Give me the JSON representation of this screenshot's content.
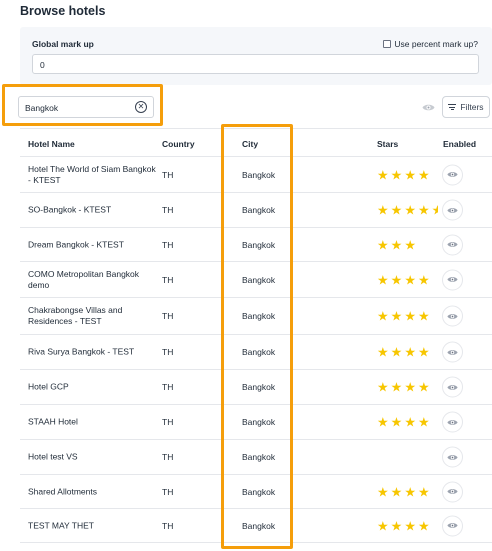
{
  "page": {
    "title": "Browse hotels"
  },
  "markup": {
    "label": "Global mark up",
    "percent_label": "Use percent mark up?",
    "percent_checked": false,
    "value": "0"
  },
  "search": {
    "value": "Bangkok",
    "clear_icon": "clear-circle-icon"
  },
  "toolbar": {
    "visibility_icon": "eye-icon",
    "filters_label": "Filters",
    "filters_icon": "filter-lines-icon"
  },
  "colors": {
    "highlight": "#f59e0b",
    "star": "#f7c600",
    "panel": "#f5f7fa"
  },
  "table": {
    "headers": {
      "name": "Hotel Name",
      "country": "Country",
      "city": "City",
      "stars": "Stars",
      "enabled": "Enabled"
    },
    "rows": [
      {
        "name": "Hotel The World of Siam Bangkok - KTEST",
        "country": "TH",
        "city": "Bangkok",
        "stars": 4
      },
      {
        "name": "SO-Bangkok - KTEST",
        "country": "TH",
        "city": "Bangkok",
        "stars": 4.5
      },
      {
        "name": "Dream Bangkok - KTEST",
        "country": "TH",
        "city": "Bangkok",
        "stars": 3
      },
      {
        "name": "COMO Metropolitan Bangkok demo",
        "country": "TH",
        "city": "Bangkok",
        "stars": 4
      },
      {
        "name": "Chakrabongse Villas and Residences - TEST",
        "country": "TH",
        "city": "Bangkok",
        "stars": 4
      },
      {
        "name": "Riva Surya Bangkok - TEST",
        "country": "TH",
        "city": "Bangkok",
        "stars": 4
      },
      {
        "name": "Hotel GCP",
        "country": "TH",
        "city": "Bangkok",
        "stars": 4
      },
      {
        "name": "STAAH Hotel",
        "country": "TH",
        "city": "Bangkok",
        "stars": 4
      },
      {
        "name": "Hotel test VS",
        "country": "TH",
        "city": "Bangkok",
        "stars": 0
      },
      {
        "name": "Shared Allotments",
        "country": "TH",
        "city": "Bangkok",
        "stars": 4
      },
      {
        "name": "TEST MAY THET",
        "country": "TH",
        "city": "Bangkok",
        "stars": 4
      }
    ]
  }
}
